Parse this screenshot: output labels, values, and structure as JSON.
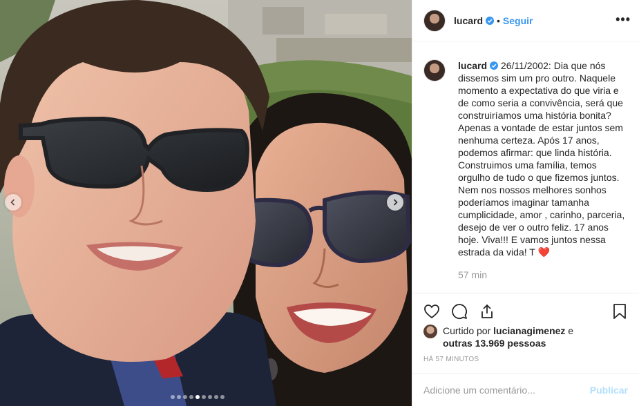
{
  "post": {
    "author": "lucard",
    "follow_label": "Seguir",
    "bullet": "•",
    "more_label": "•••",
    "caption_username": "lucard",
    "caption_text": " 26/11/2002: Dia que nós dissemos sim um pro outro. Naquele momento a expectativa do que viria e de como seria a convivência, será que construiríamos uma história bonita? Apenas a vontade de estar juntos sem nenhuma certeza. Após 17 anos, podemos afirmar: que linda história. Construimos uma família, temos orgulho de tudo o que fizemos juntos. Nem nos nossos melhores sonhos poderíamos imaginar tamanha cumplicidade, amor , carinho, parceria, desejo de ver o outro feliz. 17 anos hoje. Viva!!! E vamos juntos nessa estrada da vida! T ",
    "caption_heart": "❤️",
    "caption_time": "57 min",
    "next_comment_preview": "… ♥",
    "likes_prefix": "Curtido por ",
    "likes_user": "lucianagimenez",
    "likes_conj": " e",
    "likes_others": "outras 13.969 pessoas",
    "time_full": "HÁ 57 MINUTOS",
    "comment_placeholder": "Adicione um comentário...",
    "publish_label": "Publicar"
  },
  "carousel": {
    "total": 9,
    "active_index": 4
  },
  "icons": {
    "like": "heart-icon",
    "comment": "comment-icon",
    "share": "share-icon",
    "save": "bookmark-icon",
    "prev": "chevron-left-icon",
    "next": "chevron-right-icon",
    "verified": "verified-badge-icon"
  },
  "colors": {
    "link": "#3897f0",
    "publish_disabled": "#b2dffc",
    "verified": "#3897f0",
    "muted": "#999999"
  }
}
